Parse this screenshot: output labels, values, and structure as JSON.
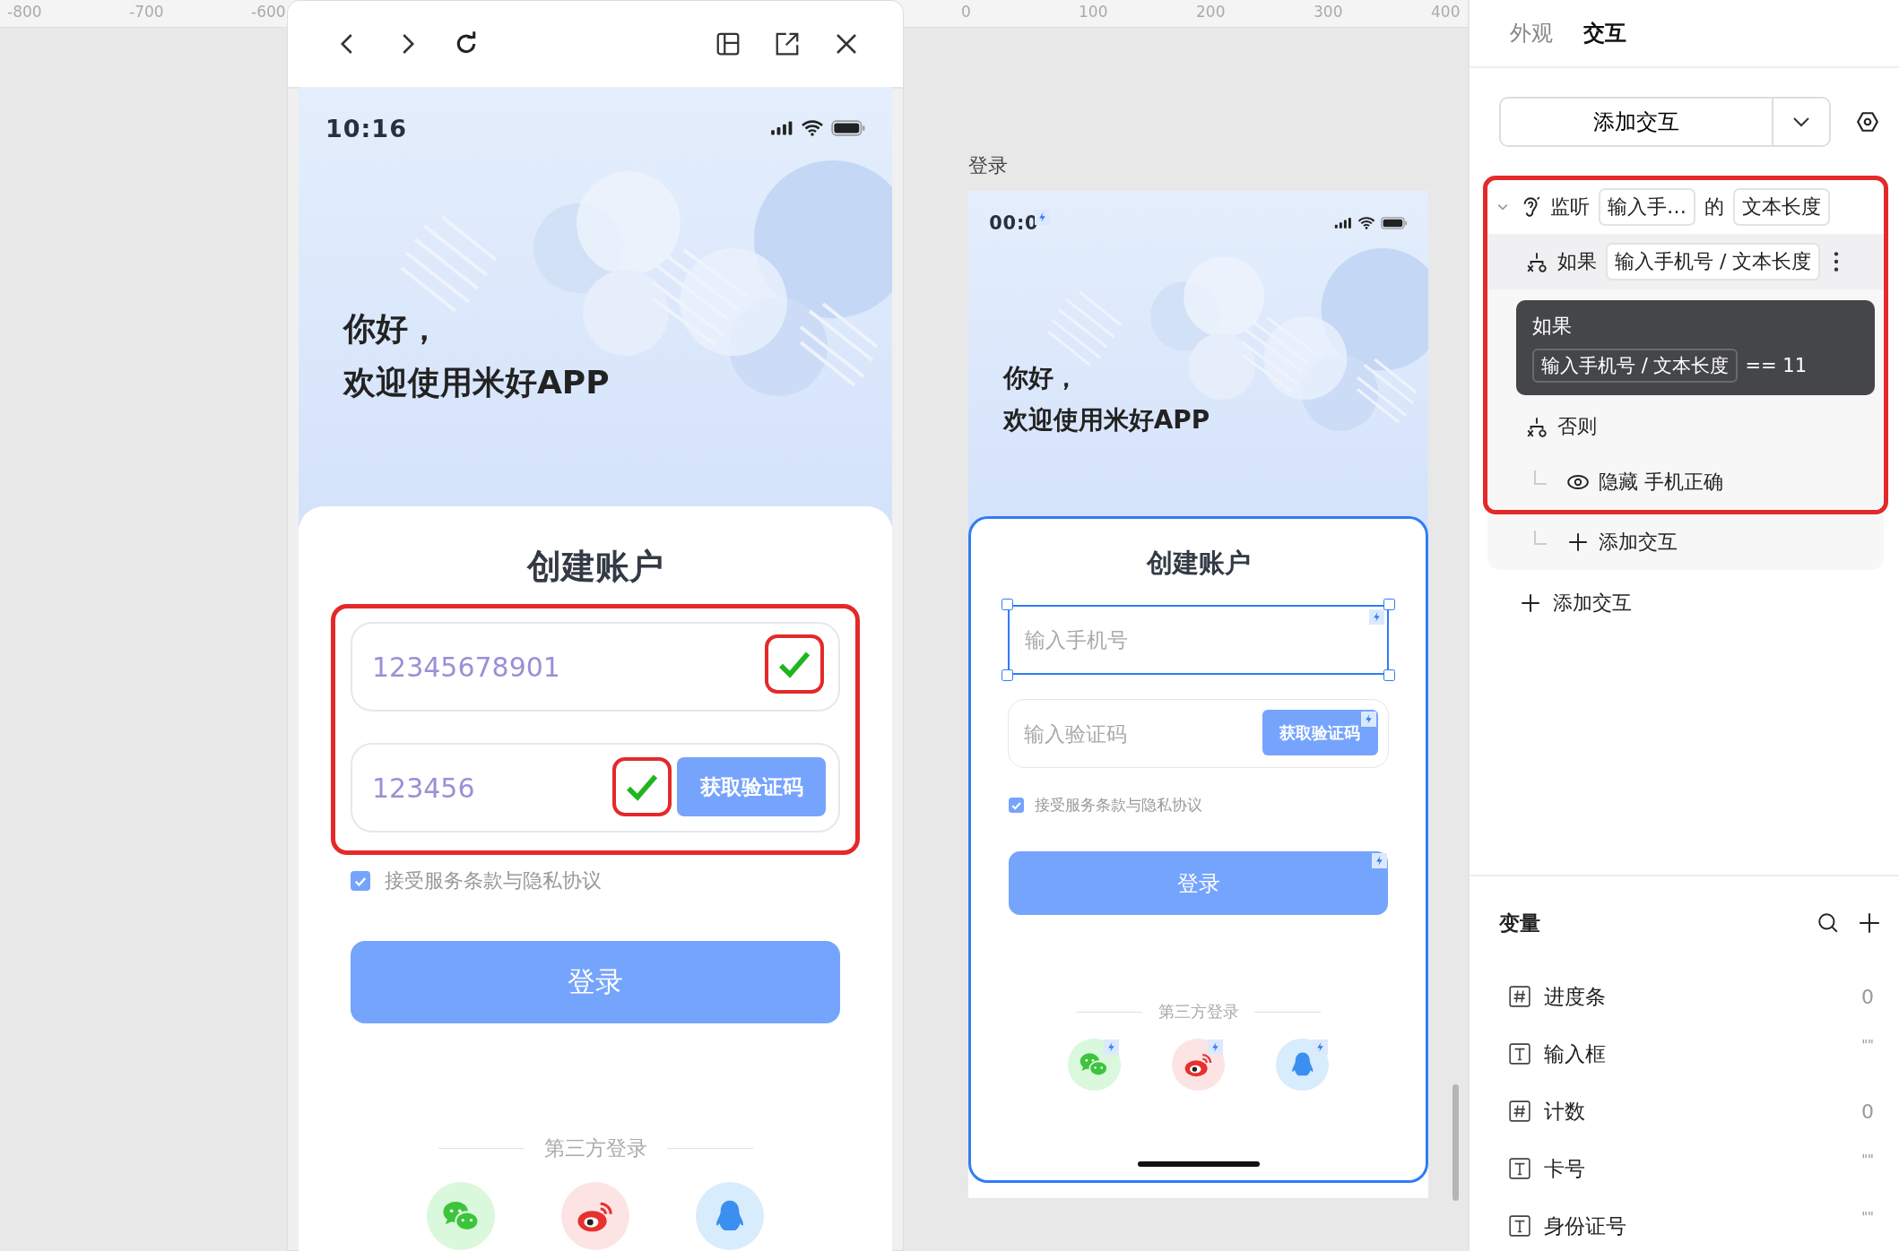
{
  "ruler": {
    "left_labels": [
      "-800",
      "-700",
      "-600"
    ],
    "right_labels": [
      "0",
      "100",
      "200",
      "300",
      "400"
    ]
  },
  "phones": [
    {
      "kind": "preview",
      "time": "10:16",
      "greeting": [
        "你好，",
        "欢迎使用米好APP"
      ],
      "card_title": "创建账户",
      "card_selected": false,
      "annotated": true,
      "show_interactions": false,
      "phone_field": {
        "value": "12345678901",
        "valid": true,
        "selected": false
      },
      "code_field": {
        "value": "123456",
        "valid": true
      },
      "code_button": "获取验证码",
      "agree": {
        "label": "接受服务条款与隐私协议",
        "checked": true
      },
      "login_button": "登录",
      "third_party_label": "第三方登录"
    },
    {
      "kind": "artboard",
      "label": "登录",
      "time": "00:0",
      "greeting": [
        "你好，",
        "欢迎使用米好APP"
      ],
      "card_title": "创建账户",
      "card_selected": true,
      "annotated": false,
      "show_interactions": true,
      "phone_field": {
        "placeholder": "输入手机号",
        "valid": false,
        "selected": true
      },
      "code_field": {
        "placeholder": "输入验证码",
        "valid": false
      },
      "code_button": "获取验证码",
      "agree": {
        "label": "接受服务条款与隐私协议",
        "checked": true
      },
      "login_button": "登录",
      "third_party_label": "第三方登录"
    }
  ],
  "panel": {
    "tabs": [
      {
        "label": "外观",
        "selected": false
      },
      {
        "label": "交互",
        "selected": true
      }
    ],
    "add_button": "添加交互",
    "listener": {
      "expanded": true,
      "annotated": true,
      "label": "监听",
      "target": "输入手…",
      "joiner": "的",
      "property": "文本长度",
      "children": [
        {
          "kind": "condition",
          "label": "如果",
          "condition": "输入手机号 / 文本长度",
          "tooltip": {
            "title": "如果",
            "condition": "输入手机号 / 文本长度",
            "operator": "== 11"
          }
        },
        {
          "kind": "else",
          "label": "否则",
          "children": [
            {
              "kind": "action",
              "verb": "隐藏",
              "target": "手机正确"
            }
          ]
        },
        {
          "kind": "add",
          "label": "添加交互"
        }
      ]
    },
    "add_link": "添加交互",
    "variables_title": "变量",
    "variables": [
      {
        "kind": "number",
        "name": "进度条",
        "value": "0"
      },
      {
        "kind": "text",
        "name": "输入框",
        "value": "\"\""
      },
      {
        "kind": "number",
        "name": "计数",
        "value": "0"
      },
      {
        "kind": "text",
        "name": "卡号",
        "value": "\"\""
      },
      {
        "kind": "text",
        "name": "身份证号",
        "value": "\"\""
      }
    ]
  }
}
